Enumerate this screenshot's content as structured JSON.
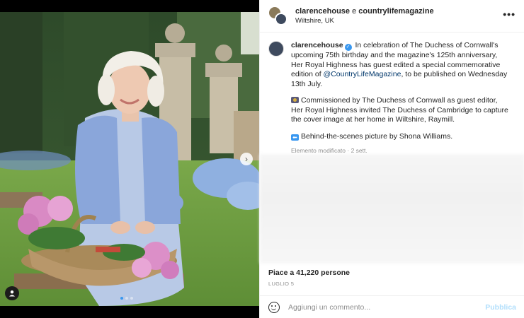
{
  "post": {
    "header": {
      "user1": "clarencehouse",
      "conjunction": "e",
      "user2": "countrylifemagazine",
      "location": "Wiltshire, UK",
      "more_icon": "more-horizontal-icon"
    },
    "caption": {
      "username": "clarencehouse",
      "text_1": " In celebration of The Duchess of Cornwall's upcoming 75th birthday and the magazine's 125th anniversary, Her Royal Highness has guest edited a special commemorative edition of ",
      "mention": "@CountryLifeMagazine",
      "text_2": ", to be published on Wednesday 13th July.",
      "para_2": "Commissioned by The Duchess of Cornwall as guest editor, Her Royal Highness invited The Duchess of Cambridge to capture the cover image at her home in Wiltshire, Raymill.",
      "para_3": "Behind-the-scenes picture by Shona Williams.",
      "edited": "Elemento modificato · 2 sett."
    },
    "likes": "Piace a 41,220 persone",
    "date": "LUGLIO 5",
    "comment": {
      "placeholder": "Aggiungi un commento...",
      "publish_label": "Pubblica"
    },
    "carousel": {
      "current": 1,
      "total": 3
    },
    "colors": {
      "verified": "#3897f0",
      "mention": "#00376b",
      "publish_disabled": "#b2dffc"
    }
  }
}
